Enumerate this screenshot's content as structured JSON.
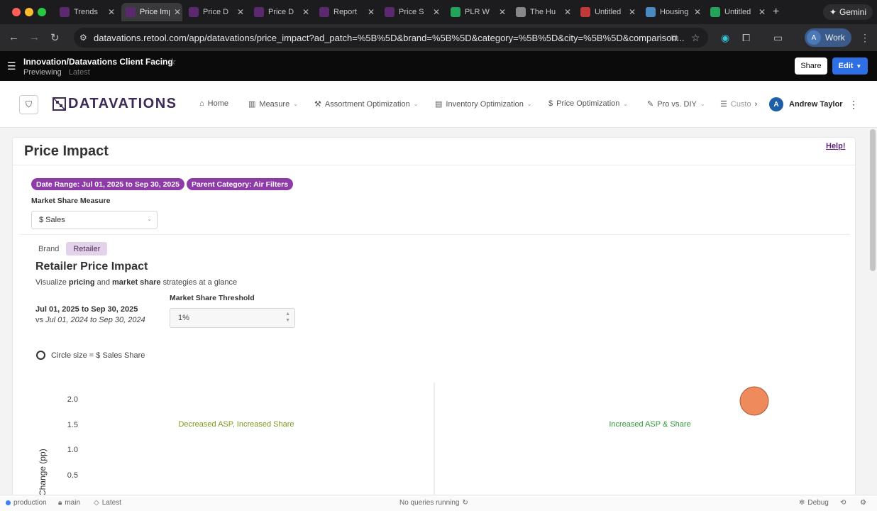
{
  "browser": {
    "tabs": [
      {
        "label": "Trends",
        "favicon": "#5b2a6e",
        "active": false
      },
      {
        "label": "Price Impact",
        "favicon": "#5b2a6e",
        "active": true
      },
      {
        "label": "Price D",
        "favicon": "#5b2a6e",
        "active": false
      },
      {
        "label": "Price D",
        "favicon": "#5b2a6e",
        "active": false
      },
      {
        "label": "Report",
        "favicon": "#5b2a6e",
        "active": false
      },
      {
        "label": "Price S",
        "favicon": "#5b2a6e",
        "active": false
      },
      {
        "label": "PLR W",
        "favicon": "#22a55a",
        "active": false
      },
      {
        "label": "The Hu",
        "favicon": "#888888",
        "active": false
      },
      {
        "label": "Untitled",
        "favicon": "#c03a3a",
        "active": false
      },
      {
        "label": "Housing",
        "favicon": "#4a8ac0",
        "active": false
      },
      {
        "label": "Untitled",
        "favicon": "#22a55a",
        "active": false
      }
    ],
    "gemini_label": "Gemini",
    "url": "datavations.retool.com/app/datavations/price_impact?ad_patch=%5B%5D&brand=%5B%5D&category=%5B%5D&city=%5B%5D&comparison...",
    "profile_label": "Work",
    "profile_initial": "A"
  },
  "retool": {
    "app_title": "Innovation/Datavations Client Facing",
    "previewing": "Previewing",
    "latest": "Latest",
    "share_label": "Share",
    "edit_label": "Edit"
  },
  "nav": {
    "brand_name": "DATAVATIONS",
    "items": [
      {
        "label": "Home",
        "icon": "home-icon"
      },
      {
        "label": "Measure",
        "icon": "bar-chart-icon"
      },
      {
        "label": "Assortment Optimization",
        "icon": "hammer-icon"
      },
      {
        "label": "Inventory Optimization",
        "icon": "box-icon"
      },
      {
        "label": "Price Optimization",
        "icon": "dollar-icon"
      },
      {
        "label": "Pro vs. DIY",
        "icon": "brush-icon"
      },
      {
        "label": "Custo",
        "icon": "list-icon"
      }
    ],
    "user_name": "Andrew Taylor",
    "user_initial": "A"
  },
  "page": {
    "title": "Price Impact",
    "help": "Help!",
    "chips": [
      "Date Range: Jul 01, 2025 to Sep 30, 2025",
      "Parent Category: Air Filters"
    ],
    "market_share_measure_label": "Market Share Measure",
    "market_share_measure_value": "$ Sales",
    "tabs": [
      {
        "label": "Brand",
        "active": false
      },
      {
        "label": "Retailer",
        "active": true
      }
    ],
    "section_title": "Retailer Price Impact",
    "desc": {
      "pre": "Visualize ",
      "bold1": "pricing",
      "mid": " and ",
      "bold2": "market share",
      "post": " strategies at a glance"
    },
    "date_range": "Jul 01, 2025 to Sep 30, 2025",
    "vs_prefix": "vs ",
    "vs_range": "Jul 01, 2024 to Sep 30, 2024",
    "threshold_label": "Market Share Threshold",
    "threshold_value": "1%",
    "circle_size_label": "Circle size = $ Sales Share"
  },
  "chart_data": {
    "type": "scatter",
    "ylabel": "Change (pp)",
    "y_ticks": [
      2.0,
      1.5,
      1.0,
      0.5
    ],
    "quadrant_labels": {
      "top_left": "Decreased ASP, Increased Share",
      "top_right": "Increased ASP & Share"
    },
    "points": [
      {
        "color": "#ef8a5c"
      }
    ]
  },
  "status": {
    "env": "production",
    "branch": "main",
    "version": "Latest",
    "queries": "No queries running",
    "debug": "Debug"
  }
}
